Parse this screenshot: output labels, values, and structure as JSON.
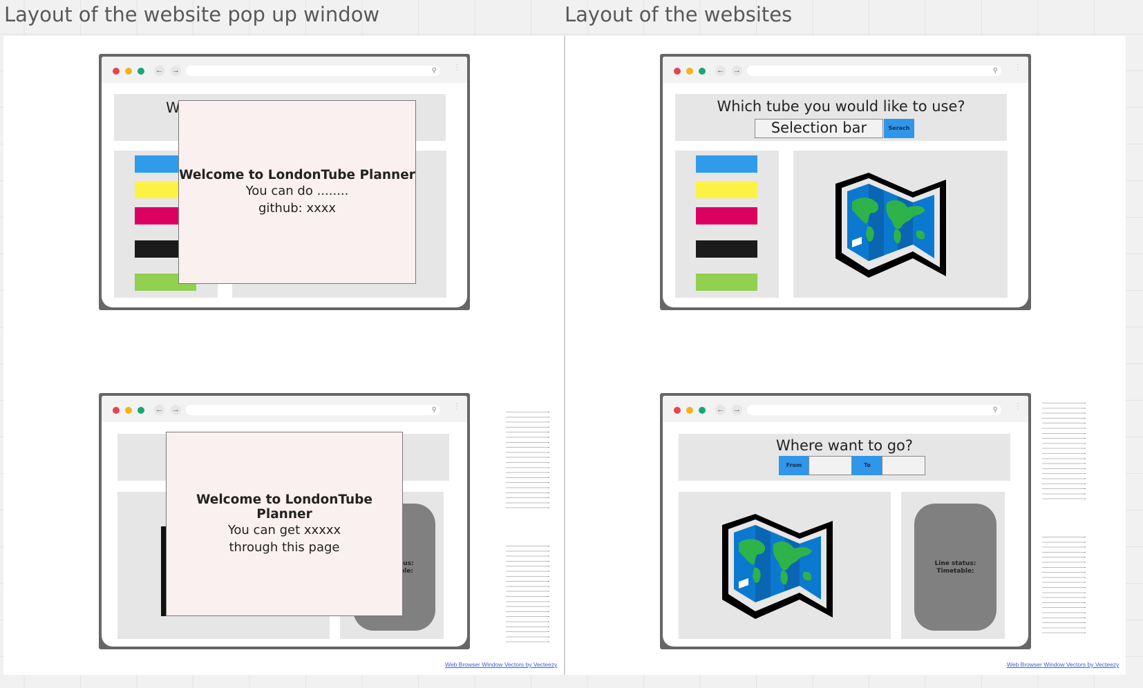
{
  "frames": {
    "popup_title": "Layout of the website pop up window",
    "websites_title": "Layout of the websites"
  },
  "popup_1": {
    "title": "Welcome to LondonTube Planner",
    "line1": "You can do ........",
    "line2": "github: xxxx",
    "hidden_heading_fragment": "W"
  },
  "popup_2": {
    "title": "Welcome to LondonTube Planner",
    "line1": "You can get xxxxx",
    "line2": "through this page",
    "status_fragment_1": "tus:",
    "status_fragment_2": "ole:"
  },
  "site_1": {
    "question": "Which tube you would like to use?",
    "selection_bar": "Selection bar",
    "search_button": "Serach"
  },
  "site_2": {
    "question": "Where want to go?",
    "from_label": "From",
    "to_label": "To",
    "line_status": "Line status:",
    "timetable": "Timetable:"
  },
  "line_colors": [
    "#2f9ceb",
    "#fdf244",
    "#dc0062",
    "#1b1b1b",
    "#92d050"
  ],
  "colors": {
    "traffic_red": "#e8434f",
    "traffic_yellow": "#f5b318",
    "traffic_green": "#1aa775",
    "accent_blue": "#2f96ea",
    "popup_bg": "#faf0ef",
    "panel_gray": "#e6e6e6",
    "status_gray": "#808080"
  },
  "credit": "Web Browser Window Vectors by Vecteezy",
  "icons": [
    "back-arrow-icon",
    "forward-arrow-icon",
    "search-icon",
    "kebab-menu-icon",
    "world-map-icon"
  ]
}
